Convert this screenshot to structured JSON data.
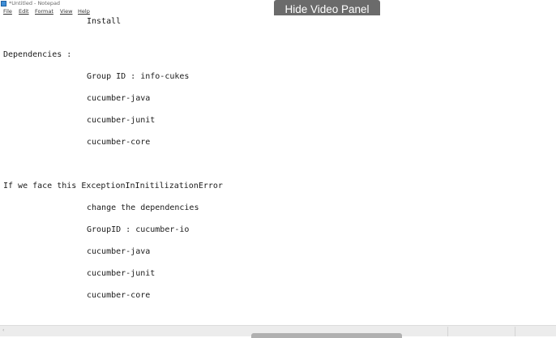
{
  "window": {
    "title": "*Untitled - Notepad",
    "icon": "notepad-icon"
  },
  "menu": [
    {
      "id": "file",
      "label": "File"
    },
    {
      "id": "edit",
      "label": "Edit"
    },
    {
      "id": "format",
      "label": "Format"
    },
    {
      "id": "view",
      "label": "View"
    },
    {
      "id": "help",
      "label": "Help"
    }
  ],
  "overlay": {
    "hide_video_label": "Hide Video Panel"
  },
  "editor": {
    "lines": [
      "Install",
      "Dependencies :",
      "Group ID : info-cukes",
      "cucumber-java",
      "cucumber-junit",
      "cucumber-core",
      "If we face this ExceptionInInitilizationError",
      "change the dependencies",
      "GroupID : cucumber-io",
      "cucumber-java",
      "cucumber-junit",
      "cucumber-core"
    ]
  },
  "scrollbar": {
    "left_arrow": "‹"
  }
}
